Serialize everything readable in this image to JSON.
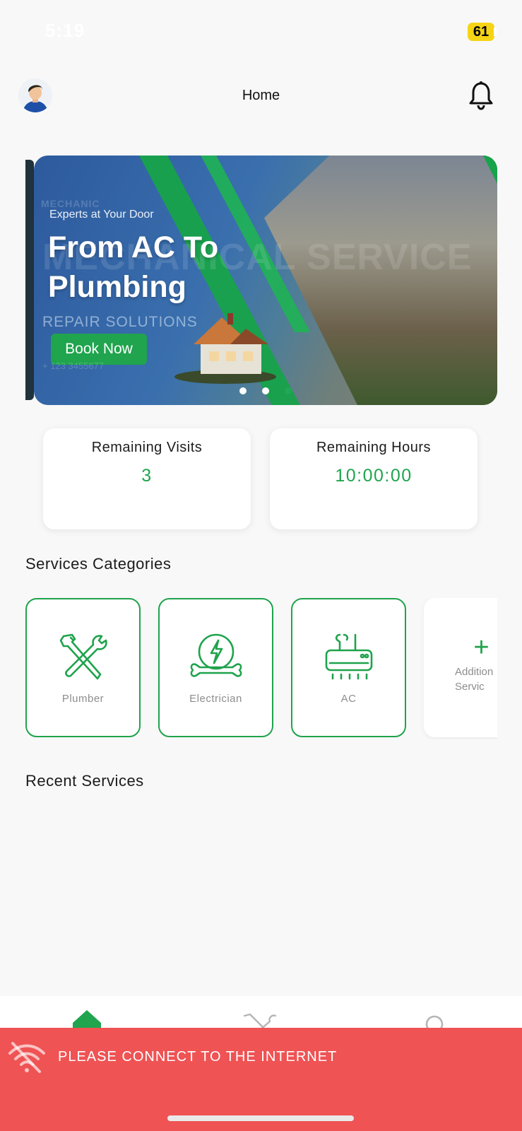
{
  "status_bar": {
    "time": "5:19",
    "battery": "61"
  },
  "header": {
    "title": "Home",
    "avatar_icon": "user-avatar",
    "notification_icon": "bell-icon"
  },
  "banner": {
    "kicker": "Experts at Your Door",
    "title": "From AC To Plumbing",
    "ghost_text": "MECHANICAL SERVICE",
    "mechanic_text": "MECHANIC",
    "subtitle": "REPAIR SOLUTIONS",
    "button_label": "Book Now",
    "phone": "+ 123 3455677",
    "dots": 3,
    "active_dot": 3
  },
  "stats": [
    {
      "label": "Remaining Visits",
      "value": "3"
    },
    {
      "label": "Remaining Hours",
      "value": "10:00:00"
    }
  ],
  "sections": {
    "categories_title": "Services Categories",
    "recent_title": "Recent Services"
  },
  "categories": [
    {
      "label": "Plumber",
      "icon": "plumber-tools-icon"
    },
    {
      "label": "Electrician",
      "icon": "electrician-icon"
    },
    {
      "label": "AC",
      "icon": "air-conditioner-icon"
    },
    {
      "label": "Additional Services",
      "icon": "plus-icon",
      "line1": "Addition",
      "line2": "Servic"
    }
  ],
  "bottom_nav": [
    {
      "name": "home",
      "icon": "home-icon",
      "active": true
    },
    {
      "name": "services",
      "icon": "tools-icon",
      "active": false
    },
    {
      "name": "search",
      "icon": "search-icon",
      "active": false
    }
  ],
  "offline": {
    "message": "PLEASE CONNECT TO THE INTERNET",
    "icon": "wifi-off-icon"
  },
  "colors": {
    "accent": "#20a44e",
    "offline_bg": "#ef5354",
    "background": "#f8f8f8"
  }
}
